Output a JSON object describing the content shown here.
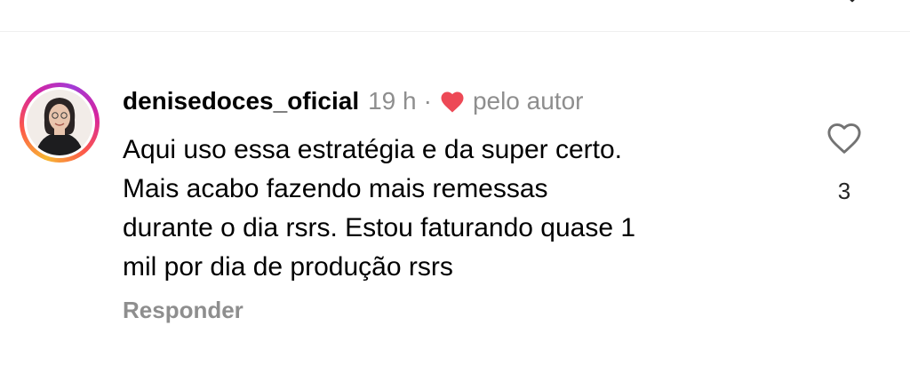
{
  "comment": {
    "username": "denisedoces_oficial",
    "time": "19 h",
    "separator": "·",
    "liked_by_author_label": "pelo autor",
    "text_lines": [
      "Aqui uso essa estratégia e da super certo.",
      "Mais acabo fazendo mais remessas",
      "durante o dia rsrs. Estou faturando quase 1",
      "mil por dia de produção rsrs"
    ],
    "reply_label": "Responder",
    "like_count": "3"
  },
  "colors": {
    "secondary_text": "#8e8e8e",
    "heart_red": "#ed4956",
    "story_ring": "instagram-gradient"
  },
  "icons": {
    "like": "heart-outline-icon",
    "author_like": "heart-filled-icon",
    "top": "chevron-down-icon"
  }
}
